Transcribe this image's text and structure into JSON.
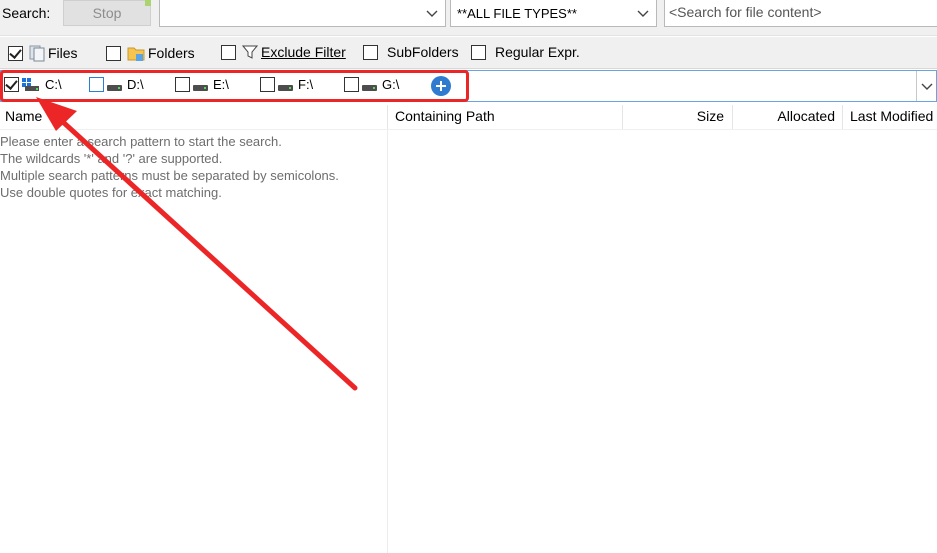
{
  "search_bar": {
    "label": "Search:",
    "stop_label": "Stop",
    "pattern_value": "",
    "file_type_value": "**ALL FILE TYPES**",
    "content_placeholder": "<Search for file content>"
  },
  "options": [
    {
      "label": "Files",
      "checked": true,
      "icon": "files-icon"
    },
    {
      "label": "Folders",
      "checked": false,
      "icon": "folder-icon"
    },
    {
      "label": "Exclude Filter",
      "checked": false,
      "icon": "filter-icon"
    },
    {
      "label": "SubFolders",
      "checked": false
    },
    {
      "label": "Regular Expr.",
      "checked": false
    }
  ],
  "drives": [
    {
      "label": "C:\\",
      "checked": true,
      "icon": "drives-grid-icon"
    },
    {
      "label": "D:\\",
      "checked": false,
      "icon": "drive-icon"
    },
    {
      "label": "E:\\",
      "checked": false,
      "icon": "drive-icon"
    },
    {
      "label": "F:\\",
      "checked": false,
      "icon": "drive-icon"
    },
    {
      "label": "G:\\",
      "checked": false,
      "icon": "drive-icon"
    }
  ],
  "columns": [
    "Name",
    "Containing Path",
    "Size",
    "Allocated",
    "Last Modified"
  ],
  "hint_lines": [
    "Please enter a search pattern to start the search.",
    "The wildcards '*' and '?' are supported.",
    "Multiple search patterns must be separated by semicolons.",
    "Use double quotes for exact matching."
  ],
  "colors": {
    "highlight": "#ec2626",
    "accent": "#2e7bd0"
  }
}
